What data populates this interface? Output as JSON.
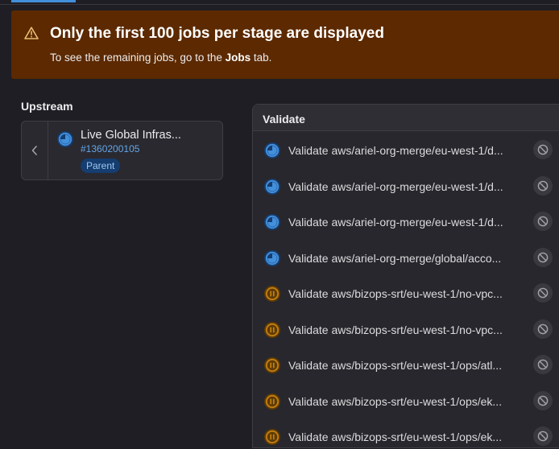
{
  "alert": {
    "title": "Only the first 100 jobs per stage are displayed",
    "body_prefix": "To see the remaining jobs, go to the ",
    "body_link": "Jobs",
    "body_suffix": " tab.",
    "icon": "warning-icon"
  },
  "upstream": {
    "heading": "Upstream",
    "pipeline": {
      "name": "Live Global Infras...",
      "id": "#1360200105",
      "badge": "Parent",
      "status_icon": "running-icon"
    }
  },
  "stage": {
    "title": "Validate",
    "jobs": [
      {
        "name": "Validate aws/ariel-org-merge/eu-west-1/d...",
        "status": "running"
      },
      {
        "name": "Validate aws/ariel-org-merge/eu-west-1/d...",
        "status": "running"
      },
      {
        "name": "Validate aws/ariel-org-merge/eu-west-1/d...",
        "status": "running"
      },
      {
        "name": "Validate aws/ariel-org-merge/global/acco...",
        "status": "running"
      },
      {
        "name": "Validate aws/bizops-srt/eu-west-1/no-vpc...",
        "status": "paused"
      },
      {
        "name": "Validate aws/bizops-srt/eu-west-1/no-vpc...",
        "status": "paused"
      },
      {
        "name": "Validate aws/bizops-srt/eu-west-1/ops/atl...",
        "status": "paused"
      },
      {
        "name": "Validate aws/bizops-srt/eu-west-1/ops/ek...",
        "status": "paused"
      },
      {
        "name": "Validate aws/bizops-srt/eu-west-1/ops/ek...",
        "status": "paused"
      }
    ]
  },
  "colors": {
    "running": "#428fdc",
    "paused": "#c17d10",
    "alert_bg": "#5c2900",
    "accent": "#428fdc"
  }
}
